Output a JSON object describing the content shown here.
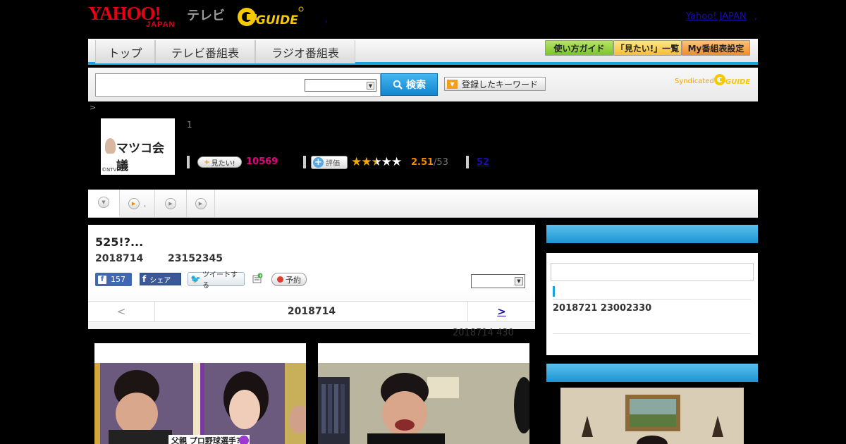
{
  "header": {
    "logo_yahoo": "YAHOO!",
    "logo_japan": "JAPAN",
    "logo_tv": "テレビ",
    "logo_gguide": "G GUIDE",
    "yahoo_japan_link": "Yahoo! JAPAN"
  },
  "nav": {
    "tabs": [
      {
        "label": "トップ"
      },
      {
        "label": "テレビ番組表"
      },
      {
        "label": "ラジオ番組表"
      }
    ],
    "right_buttons": [
      {
        "label": "使い方ガイド",
        "color": "#8ccf3a"
      },
      {
        "label": "「見たい!」一覧",
        "color": "#f5c845"
      },
      {
        "label": "My番組表設定",
        "color": "#f29a3b"
      }
    ]
  },
  "search": {
    "input_value": "",
    "select_value": "",
    "button_label": "検索",
    "keyword_button_label": "登録したキーワード",
    "syndicated_label": "Syndicated",
    "syndicated_logo": "GUIDE"
  },
  "breadcrumb": ">",
  "program": {
    "thumb_title": "マツコ会議",
    "thumb_credit": "©NTV",
    "number": "1",
    "mitai_label": "見たい!",
    "mitai_count": "10569",
    "hyoka_label": "評価",
    "rating_stars": 2.5,
    "rating": "2.51",
    "rating_total": "/53",
    "review_count": "52"
  },
  "subtabs": {
    "tab2_suffix": "."
  },
  "episode": {
    "title": "525!?...",
    "date": "2018714",
    "time": "23152345",
    "fb_like_count": "157",
    "fb_share_label": "シェア",
    "tweet_label": "ツイートする",
    "yoyaku_label": "予約",
    "select_value": "",
    "nav_prev": "<",
    "nav_current": "2018714",
    "nav_next": ">",
    "updated": "2018714  430"
  },
  "sidebar": {
    "search_value": "",
    "next_broadcast": "2018721  23002330"
  },
  "colors": {
    "accent_blue": "#1aa3d9",
    "mitai_pink": "#e4007f",
    "rating_orange": "#f08c00"
  }
}
